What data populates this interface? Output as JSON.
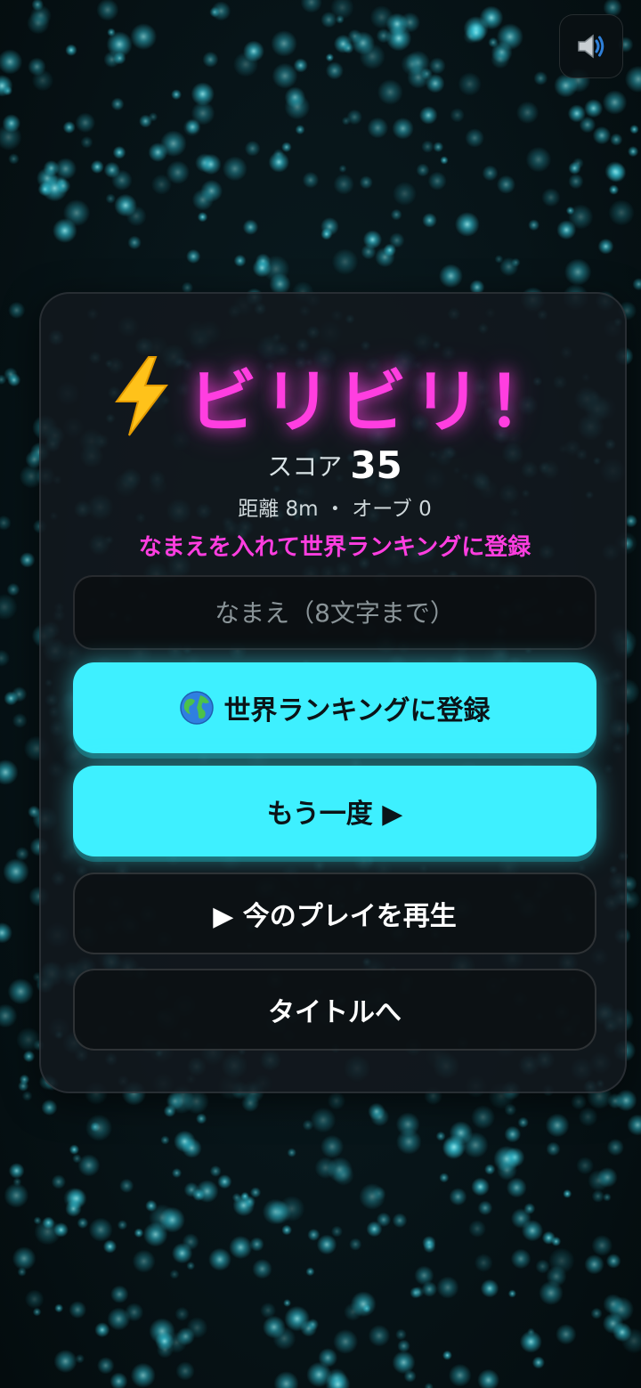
{
  "game": {
    "title": "ビリビリ！",
    "score_label": "スコア",
    "score_value": "35",
    "stats": "距離 8m ・ オーブ 0",
    "prompt": "なまえを入れて世界ランキングに登録",
    "name_placeholder": "なまえ（8文字まで）",
    "register_button": "世界ランキングに登録",
    "retry_button": "もう一度 ▶",
    "replay_button": "▶ 今のプレイを再生",
    "title_button": "タイトルへ",
    "sound_icon": "speaker-icon",
    "title_icon": "lightning-bolt-icon",
    "register_icon": "globe-icon"
  },
  "colors": {
    "accent_magenta": "#ff3ee0",
    "accent_cyan": "#3ef0ff",
    "panel_bg": "#12181e",
    "particle": "#3ee8ff"
  }
}
